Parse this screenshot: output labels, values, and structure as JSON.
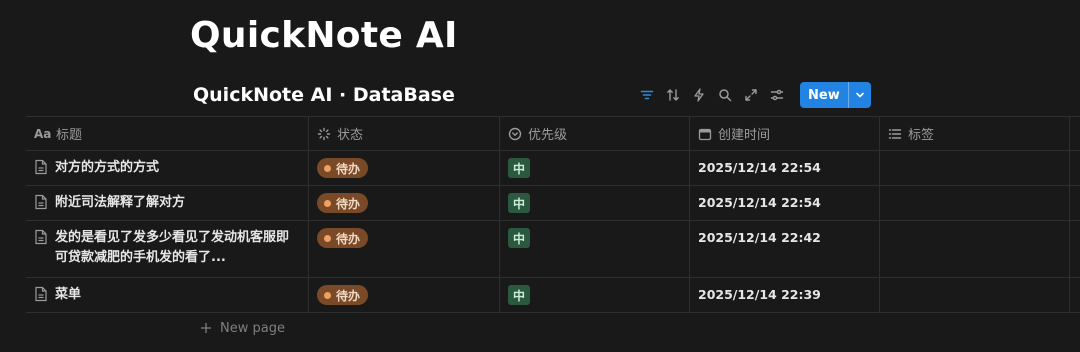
{
  "page": {
    "title": "QuickNote AI"
  },
  "database": {
    "title": "QuickNote AI · DataBase",
    "toolbar": {
      "icons": [
        "filter-icon",
        "sort-icon",
        "automation-icon",
        "search-icon",
        "expand-icon",
        "settings-icon"
      ],
      "new_label": "New"
    },
    "columns": [
      {
        "label": "标题",
        "icon": "text-type-icon"
      },
      {
        "label": "状态",
        "icon": "status-icon"
      },
      {
        "label": "优先级",
        "icon": "select-icon"
      },
      {
        "label": "创建时间",
        "icon": "calendar-icon"
      },
      {
        "label": "标签",
        "icon": "list-icon"
      }
    ],
    "rows": [
      {
        "title": "对方的方式的方式",
        "status": "待办",
        "priority": "中",
        "created": "2025/12/14 22:54"
      },
      {
        "title": "附近司法解释了解对方",
        "status": "待办",
        "priority": "中",
        "created": "2025/12/14 22:54"
      },
      {
        "title": "发的是看见了发多少看见了发动机客服即可贷款减肥的手机发的看了...",
        "status": "待办",
        "priority": "中",
        "created": "2025/12/14 22:42"
      },
      {
        "title": "菜单",
        "status": "待办",
        "priority": "中",
        "created": "2025/12/14 22:39"
      }
    ],
    "new_page_label": "New page"
  },
  "colors": {
    "background": "#191919",
    "accent": "#2383e2",
    "status_badge": "#7a4a28",
    "priority_badge": "#2b593f"
  }
}
